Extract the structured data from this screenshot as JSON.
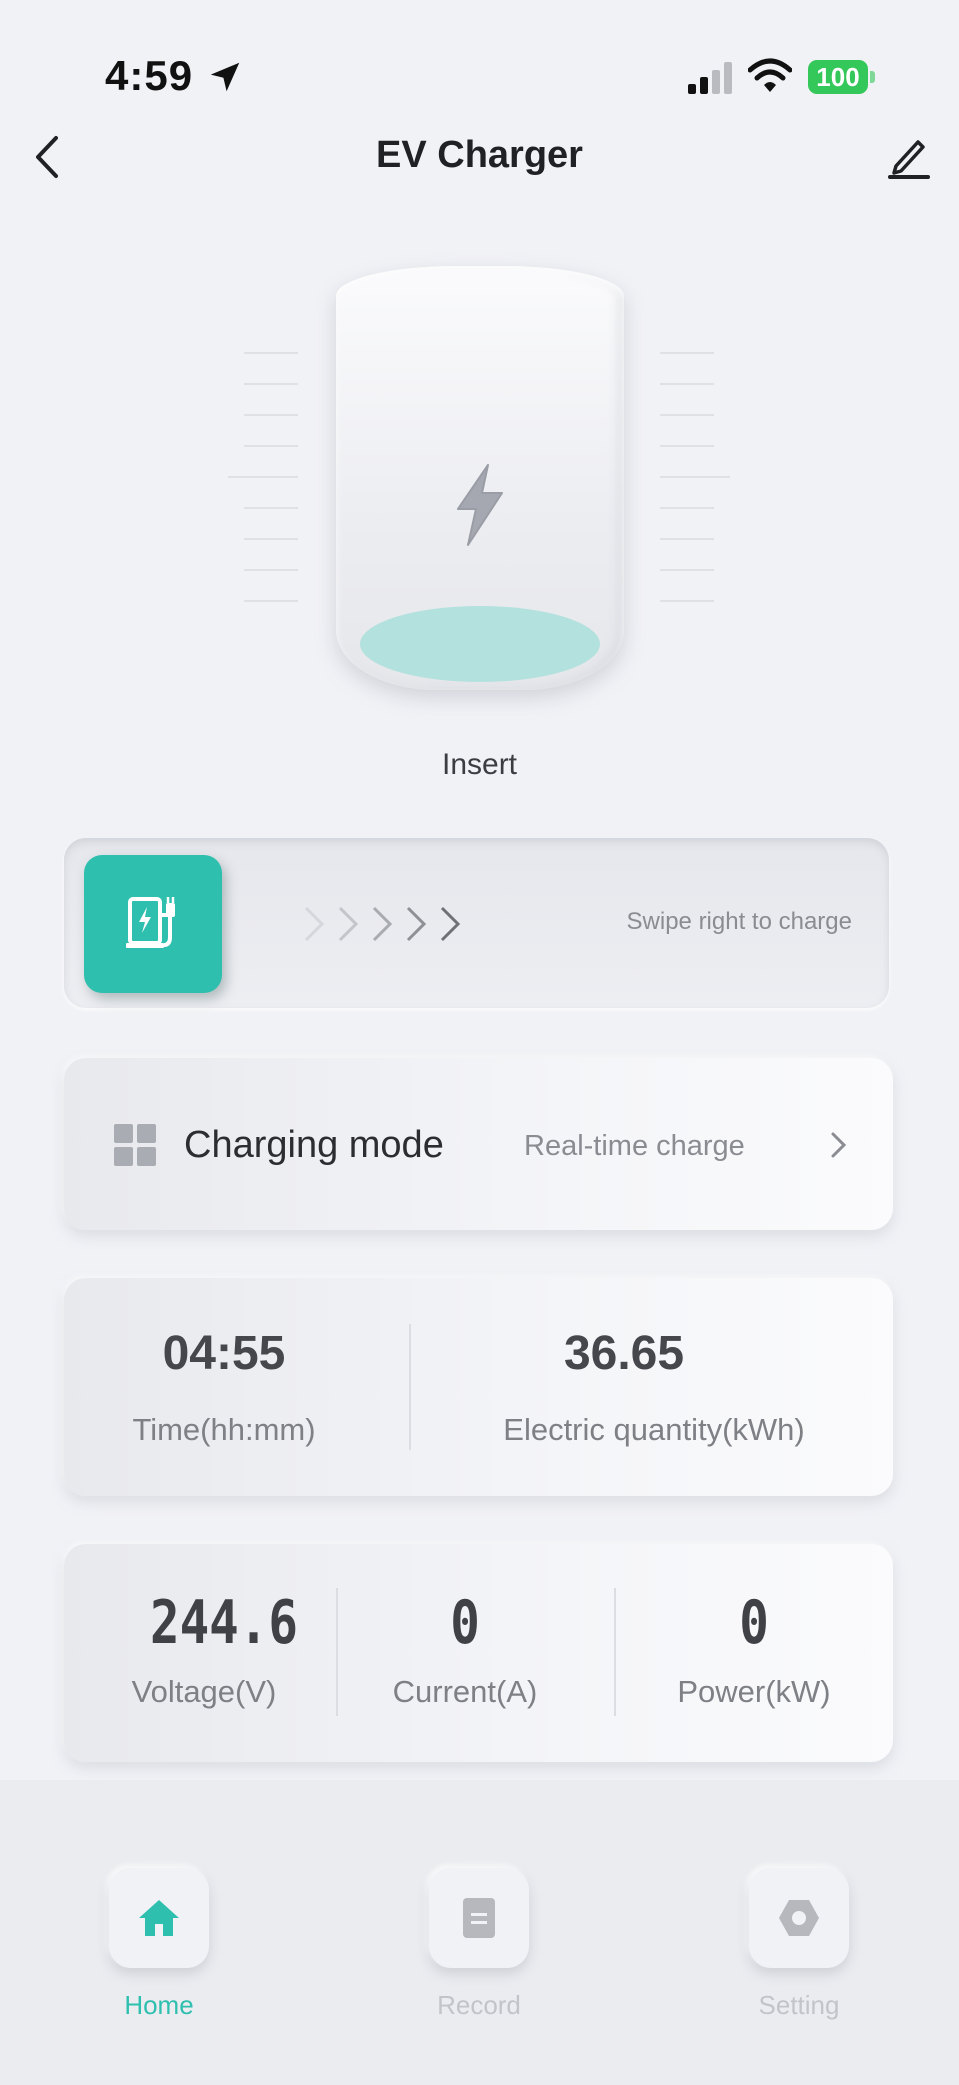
{
  "status_bar": {
    "time": "4:59",
    "battery": "100",
    "battery_color": "#34c759"
  },
  "header": {
    "title": "EV Charger",
    "back_icon": "chevron-left-icon",
    "edit_icon": "pencil-icon"
  },
  "charger": {
    "status": "Insert",
    "glow_color": "#b3e1de",
    "icon": "lightning-bolt-icon"
  },
  "swipe": {
    "hint": "Swipe right to charge",
    "knob_color": "#2ebfaf",
    "icon": "charging-station-icon"
  },
  "charging_mode": {
    "label": "Charging mode",
    "value": "Real-time charge",
    "icon": "grid-icon"
  },
  "stats": {
    "time_value": "04:55",
    "time_label": "Time(hh:mm)",
    "energy_value": "36.65",
    "energy_label": "Electric quantity(kWh)"
  },
  "electrical": {
    "voltage_value": "244.6",
    "voltage_label": "Voltage(V)",
    "current_value": "0",
    "current_label": "Current(A)",
    "power_value": "0",
    "power_label": "Power(kW)"
  },
  "nav": {
    "items": [
      {
        "label": "Home",
        "icon": "home-icon",
        "active": true
      },
      {
        "label": "Record",
        "icon": "document-icon",
        "active": false
      },
      {
        "label": "Setting",
        "icon": "hexagon-settings-icon",
        "active": false
      }
    ],
    "accent": "#2ebfaf"
  }
}
